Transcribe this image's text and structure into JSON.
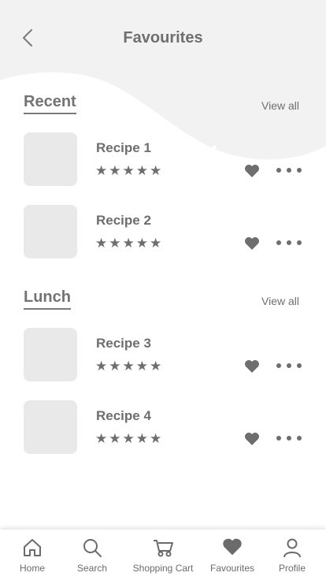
{
  "header": {
    "title": "Favourites"
  },
  "sections": [
    {
      "title": "Recent",
      "view_all": "View all",
      "recipes": [
        {
          "name": "Recipe 1",
          "stars": "★★★★★"
        },
        {
          "name": "Recipe 2",
          "stars": "★★★★★"
        }
      ]
    },
    {
      "title": "Lunch",
      "view_all": "View all",
      "recipes": [
        {
          "name": "Recipe 3",
          "stars": "★★★★★"
        },
        {
          "name": "Recipe 4",
          "stars": "★★★★★"
        }
      ]
    }
  ],
  "tabbar": {
    "items": [
      {
        "label": "Home",
        "icon": "home-icon"
      },
      {
        "label": "Search",
        "icon": "search-icon"
      },
      {
        "label": "Shopping Cart",
        "icon": "cart-icon"
      },
      {
        "label": "Favourites",
        "icon": "heart-icon"
      },
      {
        "label": "Profile",
        "icon": "profile-icon"
      }
    ]
  },
  "colors": {
    "header_bg": "#f2f2f2",
    "text": "#6e6e6e",
    "thumb": "#e9e9e9"
  }
}
